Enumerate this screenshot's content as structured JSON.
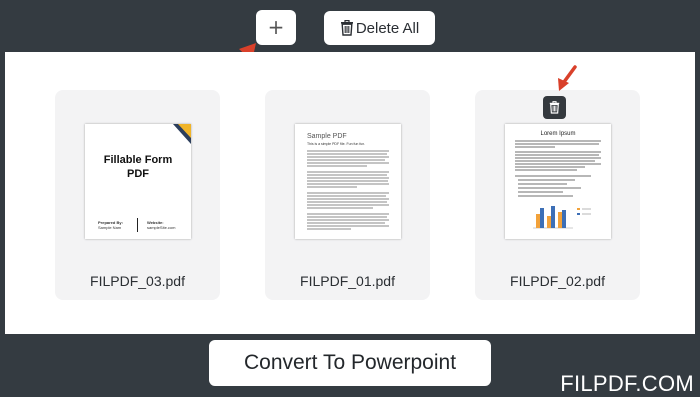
{
  "toolbar": {
    "add_label": "+",
    "delete_all_label": "Delete All"
  },
  "files": [
    {
      "name": "FILPDF_03.pdf",
      "preview": {
        "title_line1": "Fillable Form",
        "title_line2": "PDF",
        "footer_left_label": "Prepared By:",
        "footer_left_value": "Sample Nam",
        "footer_right_label": "Website:",
        "footer_right_value": "sampleSite.com"
      }
    },
    {
      "name": "FILPDF_01.pdf",
      "preview": {
        "title": "Sample PDF",
        "subtitle": "This is a simple PDF file. Fun fun fun."
      }
    },
    {
      "name": "FILPDF_02.pdf",
      "preview": {
        "title": "Lorem Ipsum"
      }
    }
  ],
  "actions": {
    "convert_label": "Convert To Powerpoint"
  },
  "brand": "FILPDF.COM",
  "colors": {
    "background": "#343b41",
    "canvas": "#ffffff",
    "card": "#f3f3f4",
    "arrow": "#d9402a",
    "trash_button": "#34393e"
  },
  "icons": {
    "add": "plus-icon",
    "delete_all": "trash-icon",
    "file_delete": "trash-icon"
  }
}
